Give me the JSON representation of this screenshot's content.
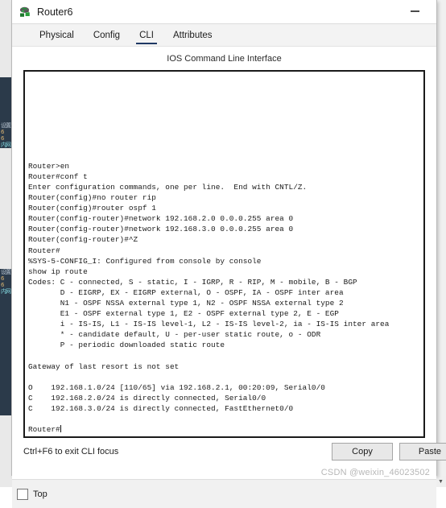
{
  "window": {
    "title": "Router6",
    "icon": "router-icon",
    "minimize_label": "—"
  },
  "tabs": [
    {
      "label": "Physical",
      "active": false
    },
    {
      "label": "Config",
      "active": false
    },
    {
      "label": "CLI",
      "active": true
    },
    {
      "label": "Attributes",
      "active": false
    }
  ],
  "panel": {
    "heading": "IOS Command Line Interface"
  },
  "terminal": {
    "lines": [
      "",
      "",
      "",
      "",
      "",
      "",
      "",
      "",
      "Router>en",
      "Router#conf t",
      "Enter configuration commands, one per line.  End with CNTL/Z.",
      "Router(config)#no router rip",
      "Router(config)#router ospf 1",
      "Router(config-router)#network 192.168.2.0 0.0.0.255 area 0",
      "Router(config-router)#network 192.168.3.0 0.0.0.255 area 0",
      "Router(config-router)#^Z",
      "Router#",
      "%SYS-5-CONFIG_I: Configured from console by console",
      "show ip route",
      "Codes: C - connected, S - static, I - IGRP, R - RIP, M - mobile, B - BGP",
      "       D - EIGRP, EX - EIGRP external, O - OSPF, IA - OSPF inter area",
      "       N1 - OSPF NSSA external type 1, N2 - OSPF NSSA external type 2",
      "       E1 - OSPF external type 1, E2 - OSPF external type 2, E - EGP",
      "       i - IS-IS, L1 - IS-IS level-1, L2 - IS-IS level-2, ia - IS-IS inter area",
      "       * - candidate default, U - per-user static route, o - ODR",
      "       P - periodic downloaded static route",
      "",
      "Gateway of last resort is not set",
      "",
      "O    192.168.1.0/24 [110/65] via 192.168.2.1, 00:20:09, Serial0/0",
      "C    192.168.2.0/24 is directly connected, Serial0/0",
      "C    192.168.3.0/24 is directly connected, FastEthernet0/0",
      "",
      "Router#"
    ],
    "prompt_has_caret": true
  },
  "actions": {
    "focus_hint": "Ctrl+F6 to exit CLI focus",
    "copy_label": "Copy",
    "paste_label": "Paste"
  },
  "footer": {
    "top_label": "Top",
    "top_checked": false
  },
  "watermark": "CSDN @weixin_46023502",
  "background": {
    "scroll_down_glyph": "▼",
    "sidebar_rows": [
      "设置",
      "6",
      "6",
      "内网"
    ]
  },
  "colors": {
    "tab_accent": "#1f3864",
    "terminal_border": "#1a1a1a",
    "sidebar_bg": "#2b3a4a",
    "button_bg": "#e8e8e8",
    "footer_bg": "#f1f1f1",
    "watermark": "#b7b7b7"
  }
}
